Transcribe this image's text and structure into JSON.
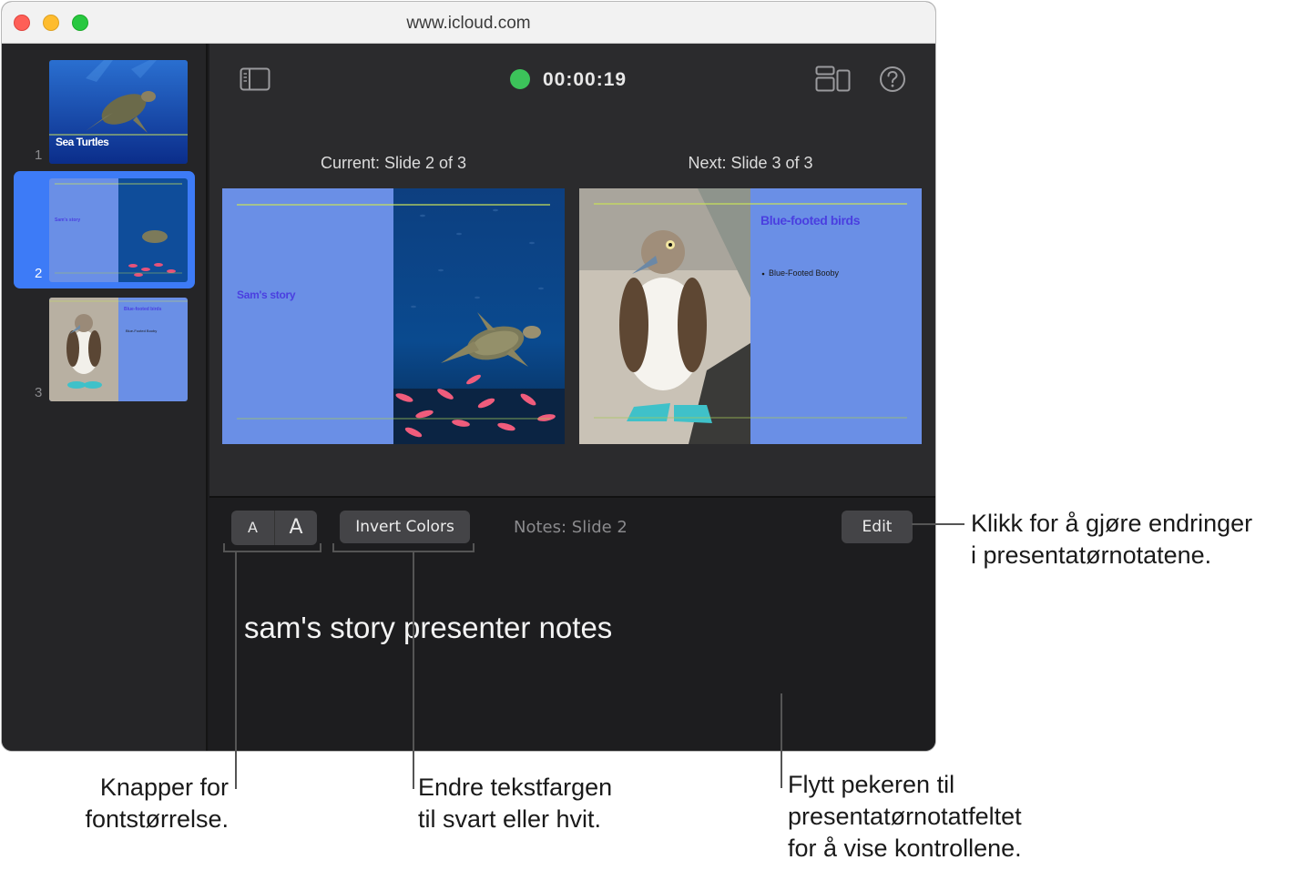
{
  "window": {
    "url": "www.icloud.com"
  },
  "sidebar": {
    "slides": [
      {
        "number": "1",
        "title": "Sea Turtles"
      },
      {
        "number": "2",
        "title": "Sam's story",
        "selected": true
      },
      {
        "number": "3",
        "title": "Blue-footed birds",
        "subtitle": "Blue-Footed Booby"
      }
    ]
  },
  "toolbar": {
    "timer": "00:00:19",
    "timer_status_color": "#3cc35a"
  },
  "current_slide": {
    "label": "Current: Slide 2 of 3",
    "title": "Sam's story"
  },
  "next_slide": {
    "label": "Next: Slide 3 of 3",
    "title": "Blue-footed birds",
    "bullet": "Blue-Footed Booby"
  },
  "notes": {
    "font_small_label": "A",
    "font_large_label": "A",
    "invert_label": "Invert Colors",
    "header": "Notes: Slide 2",
    "edit_label": "Edit",
    "text": "sam's story presenter notes"
  },
  "callouts": {
    "edit": [
      "Klikk for å gjøre endringer",
      "i presentatørnotatene."
    ],
    "font": [
      "Knapper for",
      "fontstørrelse."
    ],
    "invert": [
      "Endre tekstfargen",
      "til svart eller hvit."
    ],
    "notes_field": [
      "Flytt pekeren til",
      "presentatørnotatfeltet",
      "for å vise kontrollene."
    ]
  },
  "colors": {
    "slide_blue": "#6a8fe6",
    "slide_title_purple": "#4a3fe0",
    "accent_line": "#c8e05a",
    "selection_blue": "#3d7bf7"
  }
}
